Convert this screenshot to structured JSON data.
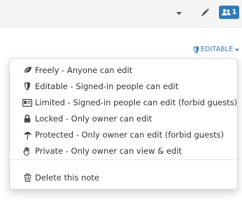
{
  "colors": {
    "accent": "#337ab7",
    "topbar_bg": "#f5f5f5",
    "text": "#333333",
    "icon": "#555555"
  },
  "toolbar": {
    "dropdown_icon": "caret-down-icon",
    "edit_icon": "pencil-icon",
    "online_users": {
      "icon": "users-icon",
      "count": "1"
    }
  },
  "permission": {
    "icon": "shield-icon",
    "label": "EDITABLE",
    "caret": "caret-down-icon"
  },
  "menu": {
    "items": [
      {
        "icon": "leaf-icon",
        "label": "Freely - Anyone can edit"
      },
      {
        "icon": "shield-icon",
        "label": "Editable - Signed-in people can edit"
      },
      {
        "icon": "id-card-icon",
        "label": "Limited - Signed-in people can edit (forbid guests)"
      },
      {
        "icon": "lock-icon",
        "label": "Locked - Only owner can edit"
      },
      {
        "icon": "umbrella-icon",
        "label": "Protected - Only owner can edit (forbid guests)"
      },
      {
        "icon": "hand-stop-icon",
        "label": "Private - Only owner can view & edit"
      }
    ],
    "delete": {
      "icon": "trash-icon",
      "label": "Delete this note"
    }
  }
}
